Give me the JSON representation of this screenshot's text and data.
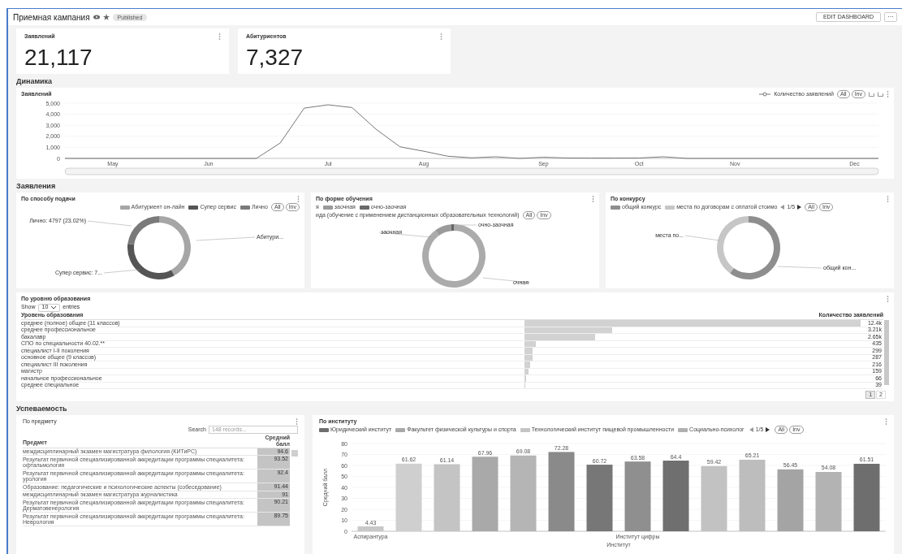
{
  "header": {
    "title": "Приемная кампания",
    "badge": "Published",
    "edit_button": "EDIT DASHBOARD",
    "more_button": "···"
  },
  "kpis": [
    {
      "title": "Заявлений",
      "value": "21,117"
    },
    {
      "title": "Абитуриентов",
      "value": "7,327"
    }
  ],
  "dynamics": {
    "heading": "Динамика",
    "title": "Заявлений",
    "toggles": [
      "All",
      "Inv"
    ],
    "chart_data": {
      "type": "line",
      "categories": [
        null,
        null,
        "May",
        null,
        null,
        null,
        "Jun",
        null,
        null,
        null,
        null,
        "Jul",
        null,
        null,
        null,
        "Aug",
        null,
        null,
        null,
        null,
        "Sep",
        null,
        null,
        null,
        "Oct",
        null,
        null,
        null,
        "Nov",
        null,
        null,
        null,
        null,
        "Dec",
        null
      ],
      "series": [
        {
          "name": "Количество заявлений",
          "values": [
            0,
            0,
            0,
            0,
            0,
            0,
            0,
            0,
            0,
            1400,
            4550,
            4850,
            4600,
            2650,
            1050,
            650,
            200,
            50,
            150,
            0,
            100,
            40,
            30,
            30,
            40,
            150,
            0,
            0,
            0,
            0,
            0,
            0,
            0,
            0,
            0
          ]
        }
      ],
      "ylim": [
        0,
        5000
      ],
      "grid": true,
      "yticks": [
        {
          "value": 0,
          "label": "0"
        },
        {
          "value": 1000,
          "label": "1,000"
        },
        {
          "value": 2000,
          "label": "2,000"
        },
        {
          "value": 3000,
          "label": "3,000"
        },
        {
          "value": 4000,
          "label": "4,000"
        },
        {
          "value": 5000,
          "label": "5,000"
        }
      ]
    }
  },
  "applications": {
    "heading": "Заявления",
    "donuts": [
      {
        "title": "По способу подачи",
        "legend": [
          {
            "label": "Абитуриент он-лайн",
            "color": "#a6a6a6"
          },
          {
            "label": "Супер сервис",
            "color": "#555555"
          },
          {
            "label": "Лично",
            "color": "#7a7a7a"
          }
        ],
        "toggles": [
          "All",
          "Inv"
        ],
        "labels": [
          "Лично: 4797 (23.02%)",
          "Абитури...",
          "Супер сервис: 7..."
        ]
      },
      {
        "title": "По форме обучения",
        "legend": [
          {
            "label": "я"
          },
          {
            "label": "заочная",
            "color": "#9a9a9a"
          },
          {
            "label": "очно-заочная",
            "color": "#6a6a6a"
          }
        ],
        "legend_line": "ида (обучение с применением дистанционных образовательных технологий)",
        "toggles": [
          "All",
          "Inv"
        ],
        "labels": [
          "очно-заочная",
          "заочная",
          "очная"
        ]
      },
      {
        "title": "По конкурсу",
        "legend": [
          {
            "label": "общий конкурс",
            "color": "#8e8e8e"
          },
          {
            "label": "места по договорам с оплатой стоимо",
            "color": "#c6c6c6"
          }
        ],
        "pager": "1/5",
        "toggles": [
          "All",
          "Inv"
        ],
        "labels": [
          "места по...",
          "общий кон..."
        ]
      }
    ],
    "education_table": {
      "title": "По уровню образования",
      "show": "Show",
      "page_size": "10",
      "entries": "entries",
      "columns": [
        "Уровень образования",
        "Количество заявлений"
      ],
      "rows": [
        {
          "name": "среднее (полное) общее (11 классов)",
          "value": "12.4k"
        },
        {
          "name": "среднее профессиональное",
          "value": "3.21k"
        },
        {
          "name": "бакалавр",
          "value": "2.65k"
        },
        {
          "name": "СПО по специальности 40.02.**",
          "value": "435"
        },
        {
          "name": "специалист I-II поколения",
          "value": "299"
        },
        {
          "name": "основное общее (9 классов)",
          "value": "287"
        },
        {
          "name": "специалист III поколения",
          "value": "216"
        },
        {
          "name": "магистр",
          "value": "159"
        },
        {
          "name": "начальное профессиональное",
          "value": "66"
        },
        {
          "name": "среднее специальное",
          "value": "39"
        }
      ],
      "pages": [
        {
          "label": "1",
          "selected": true
        },
        {
          "label": "2",
          "selected": false
        }
      ]
    }
  },
  "performance": {
    "heading": "Успеваемость",
    "subjects": {
      "title": "По предмету",
      "search_label": "Search",
      "search_placeholder": "148 records...",
      "columns": [
        "Предмет",
        "Средний балл"
      ],
      "rows": [
        {
          "name": "междисциплинарный экзамен магистратура филология (КИТиРС)",
          "value": "94.6"
        },
        {
          "name": "Результат первичной специализированной аккредитации программы специалитета: офтальмология",
          "value": "93.52"
        },
        {
          "name": "Результат первичной специализированной аккредитации программы специалитета: урология",
          "value": "92.4"
        },
        {
          "name": "Образование: педагогические и психологические аспекты (собеседование)",
          "value": "91.44"
        },
        {
          "name": "междисциплинарный экзамен магистратура журналистика",
          "value": "91"
        },
        {
          "name": "Результат первичной специализированной аккредитации программы специалитета: Дерматовенерология",
          "value": "90.21"
        },
        {
          "name": "Результат первичной специализированной аккредитации программы специалитета: Неврология",
          "value": "89.75"
        }
      ]
    },
    "institutes": {
      "title": "По институту",
      "legend": [
        {
          "label": "Юридический институт",
          "color": "#6e6e6e"
        },
        {
          "label": "Факультет физической культуры и спорта",
          "color": "#a8a8a8"
        },
        {
          "label": "Технологический институт пищевой промышленности",
          "color": "#c4c4c4"
        },
        {
          "label": "Социально-психолог",
          "color": "#b0b0b0"
        }
      ],
      "pager": "1/5",
      "toggles": [
        "All",
        "Inv"
      ],
      "chart_data": {
        "type": "bar",
        "xlabel": "Институт",
        "ylabel": "Средний балл",
        "categories": [
          "Аспирантура",
          null,
          null,
          null,
          null,
          null,
          null,
          "Институт цифры",
          null,
          null,
          null,
          null,
          null,
          null
        ],
        "values": [
          4.43,
          61.62,
          61.14,
          67.96,
          69.08,
          72.28,
          60.72,
          63.58,
          64.4,
          59.42,
          65.21,
          56.45,
          54.08,
          61.51
        ],
        "ylim": [
          0,
          80
        ],
        "grid": true,
        "yticks": [
          0,
          10,
          20,
          30,
          40,
          50,
          60,
          70,
          80
        ],
        "data_labels": true
      }
    }
  }
}
